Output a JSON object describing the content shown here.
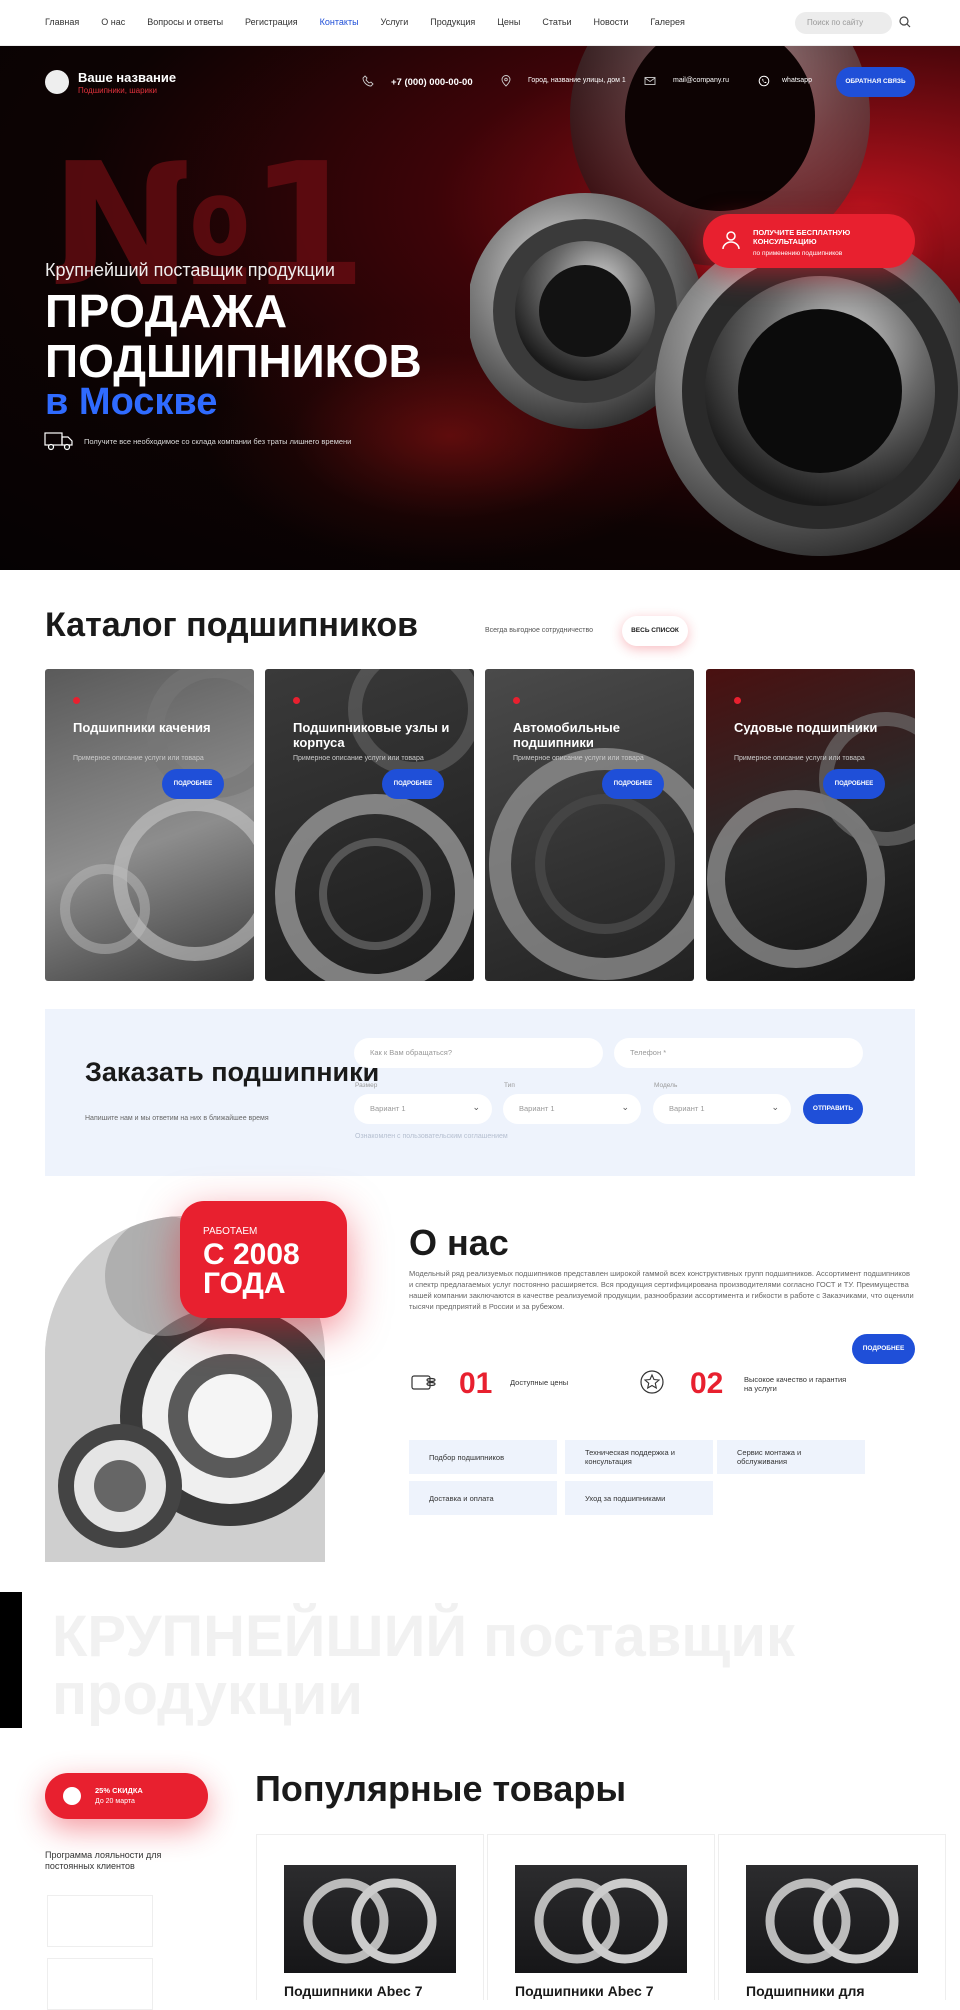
{
  "nav": {
    "links": [
      "Главная",
      "О нас",
      "Вопросы и ответы",
      "Регистрация",
      "Контакты",
      "Услуги",
      "Продукция",
      "Цены",
      "Статьи",
      "Новости",
      "Галерея"
    ],
    "active_index": 4,
    "search_placeholder": "Поиск по сайту"
  },
  "header": {
    "brand_name": "Ваше название",
    "brand_sub": "Подшипники, шарики",
    "phone": "+7 (000) 000-00-00",
    "address": "Город, название улицы, дом 1",
    "email": "mail@company.ru",
    "whatsapp": "whatsapp",
    "callback_button": "ОБРАТНАЯ СВЯЗЬ"
  },
  "hero": {
    "big_number": "№1",
    "tagline": "Крупнейший поставщик продукции",
    "title_line1": "ПРОДАЖА",
    "title_line2": "ПОДШИПНИКОВ",
    "title_line3": "в Москве",
    "note": "Получите все необходимое со склада компании без траты лишнего времени",
    "consult_title": "ПОЛУЧИТЕ БЕСПЛАТНУЮ КОНСУЛЬТАЦИЮ",
    "consult_sub": "по применению подшипников"
  },
  "catalog": {
    "title": "Каталог подшипников",
    "subtitle": "Всегда выгодное сотрудничество",
    "all_button": "ВЕСЬ СПИСОК",
    "cards": [
      {
        "title": "Подшипники качения",
        "desc": "Примерное описание услуги или товара",
        "button": "ПОДРОБНЕЕ"
      },
      {
        "title": "Подшипниковые узлы и корпуса",
        "desc": "Примерное описание услуги или товара",
        "button": "ПОДРОБНЕЕ"
      },
      {
        "title": "Автомобильные подшипники",
        "desc": "Примерное описание услуги или товара",
        "button": "ПОДРОБНЕЕ"
      },
      {
        "title": "Судовые подшипники",
        "desc": "Примерное описание услуги или товара",
        "button": "ПОДРОБНЕЕ"
      }
    ]
  },
  "order": {
    "title": "Заказать подшипники",
    "subtitle": "Напишите нам и мы ответим на них в ближайшее время",
    "name_placeholder": "Как к Вам обращаться?",
    "phone_placeholder": "Телефон *",
    "size_label": "Размер",
    "type_label": "Тип",
    "model_label": "Модель",
    "size_value": "Вариант 1",
    "type_value": "Вариант 1",
    "model_value": "Вариант 1",
    "send_button": "ОТПРАВИТЬ",
    "agreement": "Ознакомлен с пользовательским соглашением"
  },
  "about": {
    "badge_small": "РАБОТАЕМ",
    "badge_line1": "С 2008",
    "badge_line2": "ГОДА",
    "title": "О нас",
    "text": "Модельный ряд реализуемых подшипников представлен широкой гаммой всех конструктивных групп подшипников. Ассортимент подшипников и спектр предлагаемых услуг постоянно расширяется. Вся продукция сертифицирована производителями согласно ГОСТ и ТУ. Преимущества нашей компании заключаются в качестве реализуемой продукции, разнообразии ассортимента и гибкости в работе с Заказчиками, что оценили тысячи предприятий в России и за рубежом.",
    "more_button": "ПОДРОБНЕЕ",
    "features": [
      {
        "num": "01",
        "text": "Доступные цены"
      },
      {
        "num": "02",
        "text": "Высокое качество и гарантия на услуги"
      }
    ],
    "services": [
      "Подбор подшипников",
      "Техническая поддержка и консультация",
      "Сервис монтажа и обслуживания",
      "Доставка и оплата",
      "Уход за подшипниками"
    ]
  },
  "banner": {
    "line1": "КРУПНЕЙШИЙ поставщик",
    "line2": "продукции"
  },
  "popular": {
    "discount_title": "25% СКИДКА",
    "discount_sub": "До 20 марта",
    "loyalty": "Программа лояльности для постоянных клиентов",
    "title": "Популярные товары",
    "products": [
      {
        "name": "Подшипники Abec 7"
      },
      {
        "name": "Подшипники Abec 7"
      },
      {
        "name": "Подшипники для"
      }
    ]
  }
}
